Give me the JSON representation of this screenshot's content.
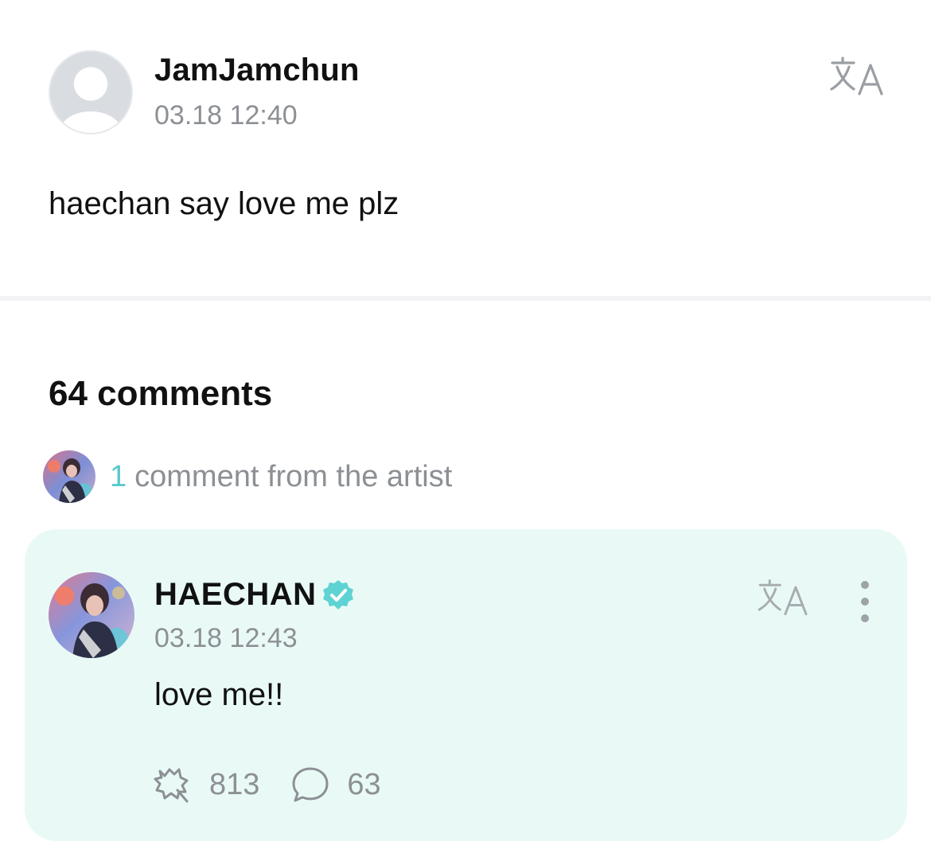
{
  "post": {
    "author": "JamJamchun",
    "timestamp": "03.18 12:40",
    "body": "haechan say love me plz",
    "translate_icon": "translate-icon"
  },
  "comments": {
    "title": "64 comments",
    "artist_count": "1",
    "artist_label": "comment from the artist",
    "artist_comment": {
      "author": "HAECHAN",
      "verified_icon": "verified-badge-icon",
      "timestamp": "03.18 12:43",
      "body": "love me!!",
      "likes": "813",
      "replies": "63"
    }
  },
  "colors": {
    "accent": "#5cc8cc",
    "card_background": "#e9faf6",
    "muted_text": "#8c9095",
    "divider": "#f2f3f5"
  }
}
